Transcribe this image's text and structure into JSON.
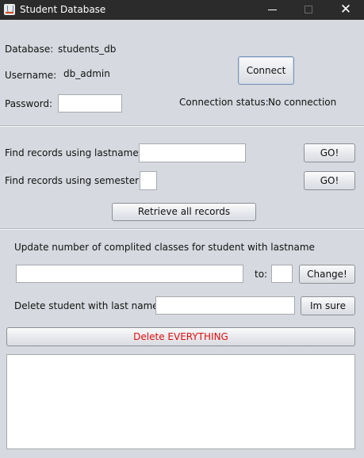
{
  "window": {
    "title": "Student Database",
    "close_glyph": "✕"
  },
  "connection": {
    "database_label": "Database:",
    "database_value": "students_db",
    "username_label": "Username:",
    "username_value": "db_admin",
    "password_label": "Password:",
    "password_value": "",
    "connect_button": "Connect",
    "status_label": "Connection status:",
    "status_value": "No connection"
  },
  "search": {
    "lastname_label": "Find records using lastname:",
    "lastname_value": "",
    "semester_label": "Find records using semester:",
    "semester_value": "",
    "go_button_1": "GO!",
    "go_button_2": "GO!",
    "retrieve_all_button": "Retrieve all records"
  },
  "update": {
    "heading": "Update number of complited classes for student with lastname",
    "lastname_value": "",
    "to_label": "to:",
    "count_value": "",
    "change_button": "Change!"
  },
  "delete": {
    "label": "Delete student with last name:",
    "lastname_value": "",
    "confirm_button": "Im sure",
    "delete_all_button": "Delete EVERYTHING",
    "danger_color": "#e01010"
  },
  "output": {
    "text": ""
  },
  "icons": [
    "app-icon",
    "minimize-icon",
    "maximize-icon",
    "close-icon"
  ]
}
